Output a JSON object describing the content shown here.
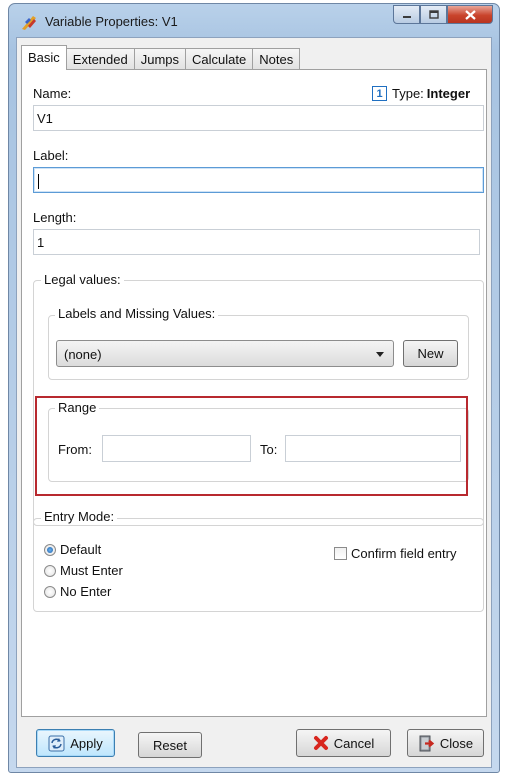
{
  "window": {
    "title": "Variable Properties: V1"
  },
  "tabs": [
    "Basic",
    "Extended",
    "Jumps",
    "Calculate",
    "Notes"
  ],
  "name": {
    "label": "Name:",
    "value": "V1"
  },
  "type": {
    "badge": "1",
    "prefix": "Type:",
    "value": "Integer"
  },
  "label_field": {
    "label": "Label:",
    "value": ""
  },
  "length": {
    "label": "Length:",
    "value": "1"
  },
  "legal_values": {
    "title": "Legal values:",
    "labels_missing": {
      "title": "Labels and Missing Values:",
      "selected": "(none)",
      "new_label": "New"
    },
    "range": {
      "title": "Range",
      "from_label": "From:",
      "from_value": "",
      "to_label": "To:",
      "to_value": ""
    }
  },
  "entry_mode": {
    "title": "Entry Mode:",
    "options": [
      "Default",
      "Must Enter",
      "No Enter"
    ],
    "selected": "Default",
    "confirm_label": "Confirm field entry"
  },
  "buttons": {
    "apply": "Apply",
    "reset": "Reset",
    "cancel": "Cancel",
    "close": "Close"
  },
  "colors": {
    "highlight": "#b8292f",
    "accent": "#1f6fc1"
  }
}
